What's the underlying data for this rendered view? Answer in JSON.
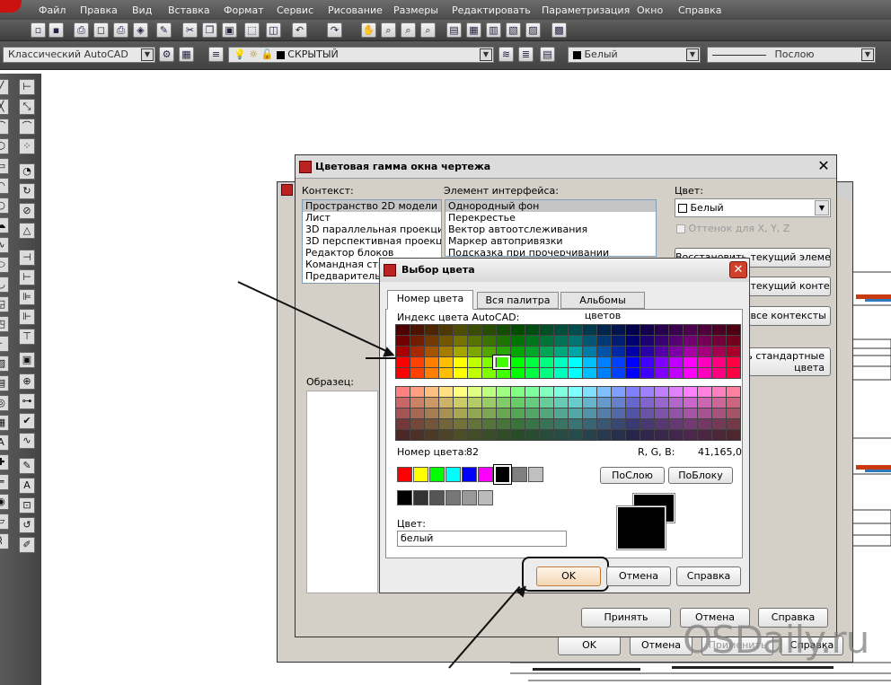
{
  "menubar": {
    "items": [
      "Файл",
      "Правка",
      "Вид",
      "Вставка",
      "Формат",
      "Сервис",
      "Рисование",
      "Размеры",
      "Редактировать",
      "Параметризация",
      "Окно",
      "Справка"
    ]
  },
  "toolbar": {
    "workspace": "Классический AutoCAD",
    "layer": "СКРЫТЫЙ",
    "color": "Белый",
    "linetype": "Послою"
  },
  "back_dialog": {
    "ok": "OK",
    "cancel": "Отмена",
    "apply": "Применить",
    "help": "Справка"
  },
  "drawing_colors": {
    "title": "Цветовая гамма окна чертежа",
    "context_label": "Контекст:",
    "context_items": [
      "Пространство 2D модели",
      "Лист",
      "3D параллельная проекция",
      "3D перспективная проекция",
      "Редактор блоков",
      "Командная стро",
      "Предварительн"
    ],
    "element_label": "Элемент интерфейса:",
    "element_items": [
      "Однородный фон",
      "Перекрестье",
      "Вектор автоотслеживания",
      "Маркер автопривязки",
      "Подсказка при прочерчивании"
    ],
    "color_label": "Цвет:",
    "color_value": "Белый",
    "tint_label": "Оттенок для X, Y, Z",
    "btn_restore_elem": "Восстановить текущий элемент",
    "btn_restore_ctx": "Восстановить текущий контекст",
    "btn_restore_all": "Восстановить все контексты",
    "btn_classic": "Восстановить стандартные цвета",
    "sample_label": "Образец:",
    "apply": "Принять",
    "cancel": "Отмена",
    "help": "Справка"
  },
  "picker": {
    "title": "Выбор цвета",
    "tabs": [
      "Номер цвета",
      "Вся палитра",
      "Альбомы цветов"
    ],
    "index_label": "Индекс цвета AutoCAD:",
    "color_number_label": "Номер цвета:",
    "color_number": "82",
    "rgb_label": "R, G, B:",
    "rgb_value": "41,165,0",
    "bylayer": "ПоСлою",
    "byblock": "ПоБлоку",
    "color_field_label": "Цвет:",
    "color_field_value": "белый",
    "ok": "OK",
    "cancel": "Отмена",
    "help": "Справка",
    "selected_color": "#29a500"
  },
  "watermark": "OSDaily.ru",
  "icons": [
    "app-logo-icon",
    "new-file-icon",
    "save-icon",
    "print-icon",
    "undo-icon",
    "zoom-icon",
    "pan-icon",
    "layer-icon",
    "close-icon",
    "line-tool-icon",
    "circle-tool-icon",
    "text-tool-icon"
  ]
}
